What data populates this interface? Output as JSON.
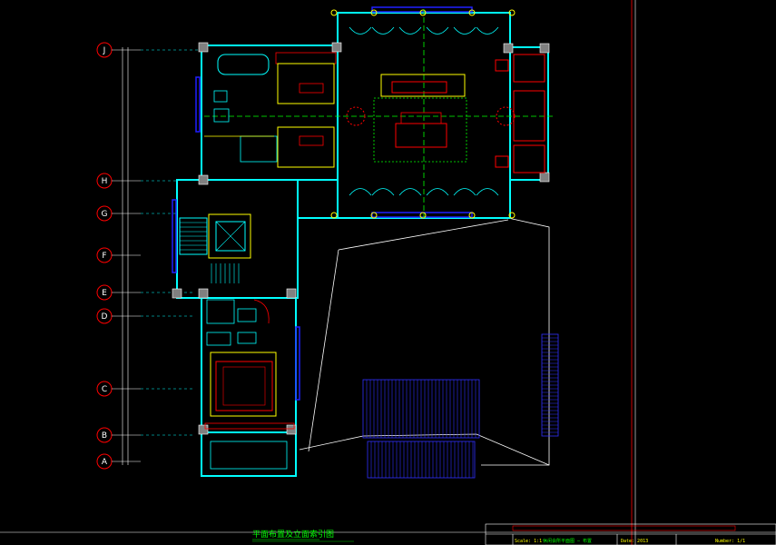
{
  "drawing": {
    "title": "平面布置及立面索引图",
    "axes": [
      "J",
      "H",
      "G",
      "F",
      "E",
      "D",
      "C",
      "B",
      "A"
    ]
  },
  "title_block": {
    "scale_label": "Scale: 1:1",
    "drawing_name": "休闲会所平面图 — 布置",
    "date_label": "Date: 2013",
    "sheet_label": "Number: 1/1"
  },
  "colors": {
    "background": "#000000",
    "wall": "#00ffff",
    "window": "#0000ff",
    "furniture": "#ff0000",
    "column": "#808080",
    "text": "#00ff00",
    "annotation": "#ffff00",
    "grid": "#ffffff"
  }
}
